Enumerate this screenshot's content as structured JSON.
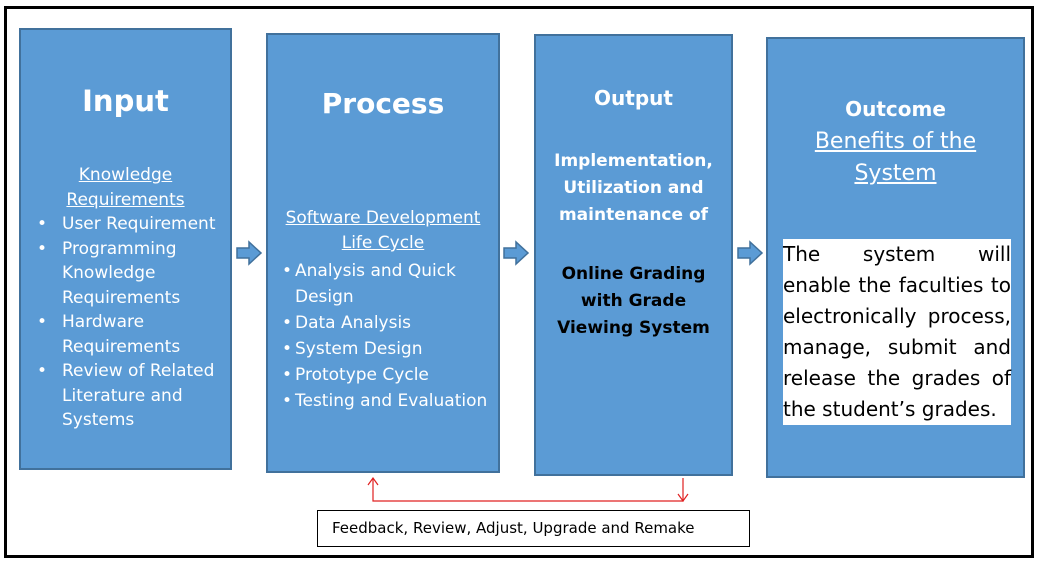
{
  "diagram": {
    "colors": {
      "box_fill": "#5b9bd5",
      "box_border": "#41719c",
      "feedback_arrow": "#e02020",
      "frame": "#000000"
    },
    "input": {
      "title": "Input",
      "subtitle_line1": "Knowledge",
      "subtitle_line2": "Requirements",
      "items": [
        {
          "lines": [
            "User Requirement"
          ]
        },
        {
          "lines": [
            "Programming",
            "Knowledge",
            "Requirements"
          ]
        },
        {
          "lines": [
            "Hardware",
            "Requirements"
          ]
        },
        {
          "lines": [
            "Review of Related",
            "Literature and",
            "Systems"
          ]
        }
      ]
    },
    "process": {
      "title": "Process",
      "subtitle_line1": "Software Development",
      "subtitle_line2": "Life Cycle",
      "items": [
        {
          "lines": [
            "Analysis and Quick",
            "Design"
          ]
        },
        {
          "lines": [
            "Data Analysis"
          ]
        },
        {
          "lines": [
            "System Design"
          ]
        },
        {
          "lines": [
            "Prototype Cycle"
          ]
        },
        {
          "lines": [
            "Testing and Evaluation"
          ]
        }
      ]
    },
    "output": {
      "title": "Output",
      "desc_line1": "Implementation,",
      "desc_line2": "Utilization and",
      "desc_line3": "maintenance of",
      "system_line1": "Online Grading",
      "system_line2": "with Grade",
      "system_line3": "Viewing System"
    },
    "outcome": {
      "title": "Outcome",
      "subtitle_line1": "Benefits of the",
      "subtitle_line2": "System",
      "text": "The system will enable the faculties to electronically process, manage, submit and release the grades of the student’s grades."
    },
    "feedback": {
      "label": "Feedback, Review, Adjust, Upgrade and Remake"
    },
    "icons": {
      "flow_arrow": "right-arrow-icon",
      "feedback_loop": "feedback-loop-arrow-icon"
    }
  }
}
